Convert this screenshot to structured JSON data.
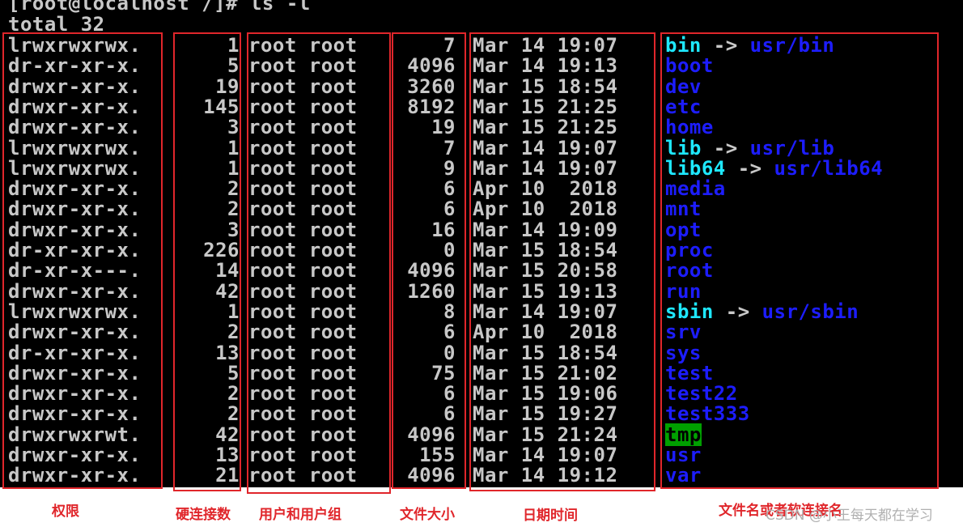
{
  "terminal": {
    "prompt": "[root@localhost /]# ls -l",
    "total": "total 32",
    "rows": [
      {
        "perm": "lrwxrwxrwx.",
        "links": "1",
        "owner": "root root",
        "size": "7",
        "date": "Mar 14 19:07",
        "name": "bin",
        "arrow": " -> ",
        "target": "usr/bin",
        "type": "link"
      },
      {
        "perm": "dr-xr-xr-x.",
        "links": "5",
        "owner": "root root",
        "size": "4096",
        "date": "Mar 14 19:13",
        "name": "boot",
        "type": "dir"
      },
      {
        "perm": "drwxr-xr-x.",
        "links": "19",
        "owner": "root root",
        "size": "3260",
        "date": "Mar 15 18:54",
        "name": "dev",
        "type": "dir"
      },
      {
        "perm": "drwxr-xr-x.",
        "links": "145",
        "owner": "root root",
        "size": "8192",
        "date": "Mar 15 21:25",
        "name": "etc",
        "type": "dir"
      },
      {
        "perm": "drwxr-xr-x.",
        "links": "3",
        "owner": "root root",
        "size": "19",
        "date": "Mar 15 21:25",
        "name": "home",
        "type": "dir"
      },
      {
        "perm": "lrwxrwxrwx.",
        "links": "1",
        "owner": "root root",
        "size": "7",
        "date": "Mar 14 19:07",
        "name": "lib",
        "arrow": " -> ",
        "target": "usr/lib",
        "type": "link"
      },
      {
        "perm": "lrwxrwxrwx.",
        "links": "1",
        "owner": "root root",
        "size": "9",
        "date": "Mar 14 19:07",
        "name": "lib64",
        "arrow": " -> ",
        "target": "usr/lib64",
        "type": "link"
      },
      {
        "perm": "drwxr-xr-x.",
        "links": "2",
        "owner": "root root",
        "size": "6",
        "date": "Apr 10  2018",
        "name": "media",
        "type": "dir"
      },
      {
        "perm": "drwxr-xr-x.",
        "links": "2",
        "owner": "root root",
        "size": "6",
        "date": "Apr 10  2018",
        "name": "mnt",
        "type": "dir"
      },
      {
        "perm": "drwxr-xr-x.",
        "links": "3",
        "owner": "root root",
        "size": "16",
        "date": "Mar 14 19:09",
        "name": "opt",
        "type": "dir"
      },
      {
        "perm": "dr-xr-xr-x.",
        "links": "226",
        "owner": "root root",
        "size": "0",
        "date": "Mar 15 18:54",
        "name": "proc",
        "type": "dir"
      },
      {
        "perm": "dr-xr-x---.",
        "links": "14",
        "owner": "root root",
        "size": "4096",
        "date": "Mar 15 20:58",
        "name": "root",
        "type": "dir"
      },
      {
        "perm": "drwxr-xr-x.",
        "links": "42",
        "owner": "root root",
        "size": "1260",
        "date": "Mar 15 19:13",
        "name": "run",
        "type": "dir"
      },
      {
        "perm": "lrwxrwxrwx.",
        "links": "1",
        "owner": "root root",
        "size": "8",
        "date": "Mar 14 19:07",
        "name": "sbin",
        "arrow": " -> ",
        "target": "usr/sbin",
        "type": "link"
      },
      {
        "perm": "drwxr-xr-x.",
        "links": "2",
        "owner": "root root",
        "size": "6",
        "date": "Apr 10  2018",
        "name": "srv",
        "type": "dir"
      },
      {
        "perm": "dr-xr-xr-x.",
        "links": "13",
        "owner": "root root",
        "size": "0",
        "date": "Mar 15 18:54",
        "name": "sys",
        "type": "dir"
      },
      {
        "perm": "drwxr-xr-x.",
        "links": "5",
        "owner": "root root",
        "size": "75",
        "date": "Mar 15 21:02",
        "name": "test",
        "type": "dir"
      },
      {
        "perm": "drwxr-xr-x.",
        "links": "2",
        "owner": "root root",
        "size": "6",
        "date": "Mar 15 19:06",
        "name": "test22",
        "type": "dir"
      },
      {
        "perm": "drwxr-xr-x.",
        "links": "2",
        "owner": "root root",
        "size": "6",
        "date": "Mar 15 19:27",
        "name": "test333",
        "type": "dir"
      },
      {
        "perm": "drwxrwxrwt.",
        "links": "42",
        "owner": "root root",
        "size": "4096",
        "date": "Mar 15 21:24",
        "name": "tmp",
        "type": "sticky"
      },
      {
        "perm": "drwxr-xr-x.",
        "links": "13",
        "owner": "root root",
        "size": "155",
        "date": "Mar 14 19:07",
        "name": "usr",
        "type": "dir"
      },
      {
        "perm": "drwxr-xr-x.",
        "links": "21",
        "owner": "root root",
        "size": "4096",
        "date": "Mar 14 19:12",
        "name": "var",
        "type": "dir"
      }
    ]
  },
  "captions": {
    "perm": "权限",
    "links": "硬连接数",
    "owner": "用户和用户组",
    "size": "文件大小",
    "date": "日期时间",
    "name": "文件名或者软连接名"
  },
  "watermark": "CSDN @小王每天都在学习",
  "colors": {
    "terminal_bg": "#000000",
    "text": "#c8c8c8",
    "dir": "#1d1dff",
    "link": "#1ee8ff",
    "sticky_bg": "#00a000",
    "annotation": "#e0262b"
  }
}
